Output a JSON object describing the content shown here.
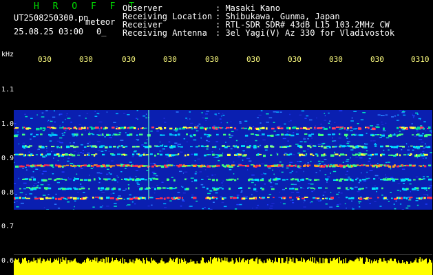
{
  "header": {
    "brand": "H R O F F T",
    "filename": "UT2508250300.pn",
    "mode": "meteor",
    "datetime": "25.08.25 03:00",
    "extra": "0_",
    "fields": [
      {
        "label": "Observer",
        "value": ": Masaki Kano"
      },
      {
        "label": "Receiving Location",
        "value": ": Shibukawa, Gunma, Japan"
      },
      {
        "label": "Receiver",
        "value": ": RTL-SDR SDR# 43dB L15 103.2MHz CW"
      },
      {
        "label": "Receiving Antenna",
        "value": ": 3el Yagi(V) Az 330 for Vladivostok"
      }
    ]
  },
  "axis": {
    "unit": "kHz",
    "y_labels": [
      "1.1",
      "1.0",
      "0.9",
      "0.8",
      "0.7",
      "0.6"
    ],
    "x_labels": [
      "030",
      "030",
      "030",
      "030",
      "030",
      "030",
      "030",
      "030",
      "030",
      "0310"
    ]
  },
  "colors": {
    "brand": "#00e000",
    "spectrum_bg": "#0a1fb0",
    "power": "#ffff00"
  }
}
